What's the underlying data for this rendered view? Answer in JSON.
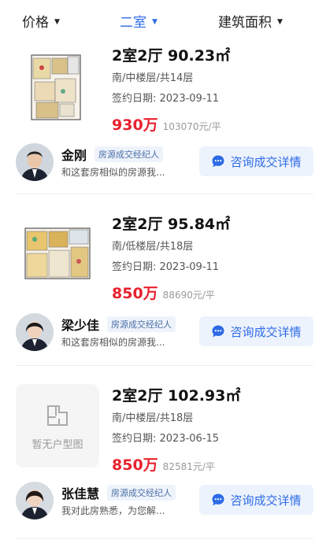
{
  "filters": [
    {
      "label": "价格",
      "active": false
    },
    {
      "label": "二室",
      "active": true
    },
    {
      "label": "建筑面积",
      "active": false
    }
  ],
  "listings": [
    {
      "title": "2室2厅 90.23㎡",
      "orientation_floor": "南/中楼层/共14层",
      "sign_date": "签约日期: 2023-09-11",
      "total_price": "930万",
      "unit_price": "103070元/平",
      "has_floorplan": true,
      "agent": {
        "name": "金刚",
        "tag": "房源成交经纪人",
        "desc": "和这套房相似的房源我...",
        "button": "咨询成交详情"
      }
    },
    {
      "title": "2室2厅 95.84㎡",
      "orientation_floor": "南/低楼层/共18层",
      "sign_date": "签约日期: 2023-09-11",
      "total_price": "850万",
      "unit_price": "88690元/平",
      "has_floorplan": true,
      "agent": {
        "name": "梁少佳",
        "tag": "房源成交经纪人",
        "desc": "和这套房相似的房源我...",
        "button": "咨询成交详情"
      }
    },
    {
      "title": "2室2厅 102.93㎡",
      "orientation_floor": "南/中楼层/共18层",
      "sign_date": "签约日期: 2023-06-15",
      "total_price": "850万",
      "unit_price": "82581元/平",
      "has_floorplan": false,
      "no_floorplan_text": "暂无户型图",
      "agent": {
        "name": "张佳慧",
        "tag": "房源成交经纪人",
        "desc": "我对此房熟悉，为您解...",
        "button": "咨询成交详情"
      }
    }
  ],
  "colors": {
    "accent": "#2d6be6",
    "price": "#e8212e"
  }
}
